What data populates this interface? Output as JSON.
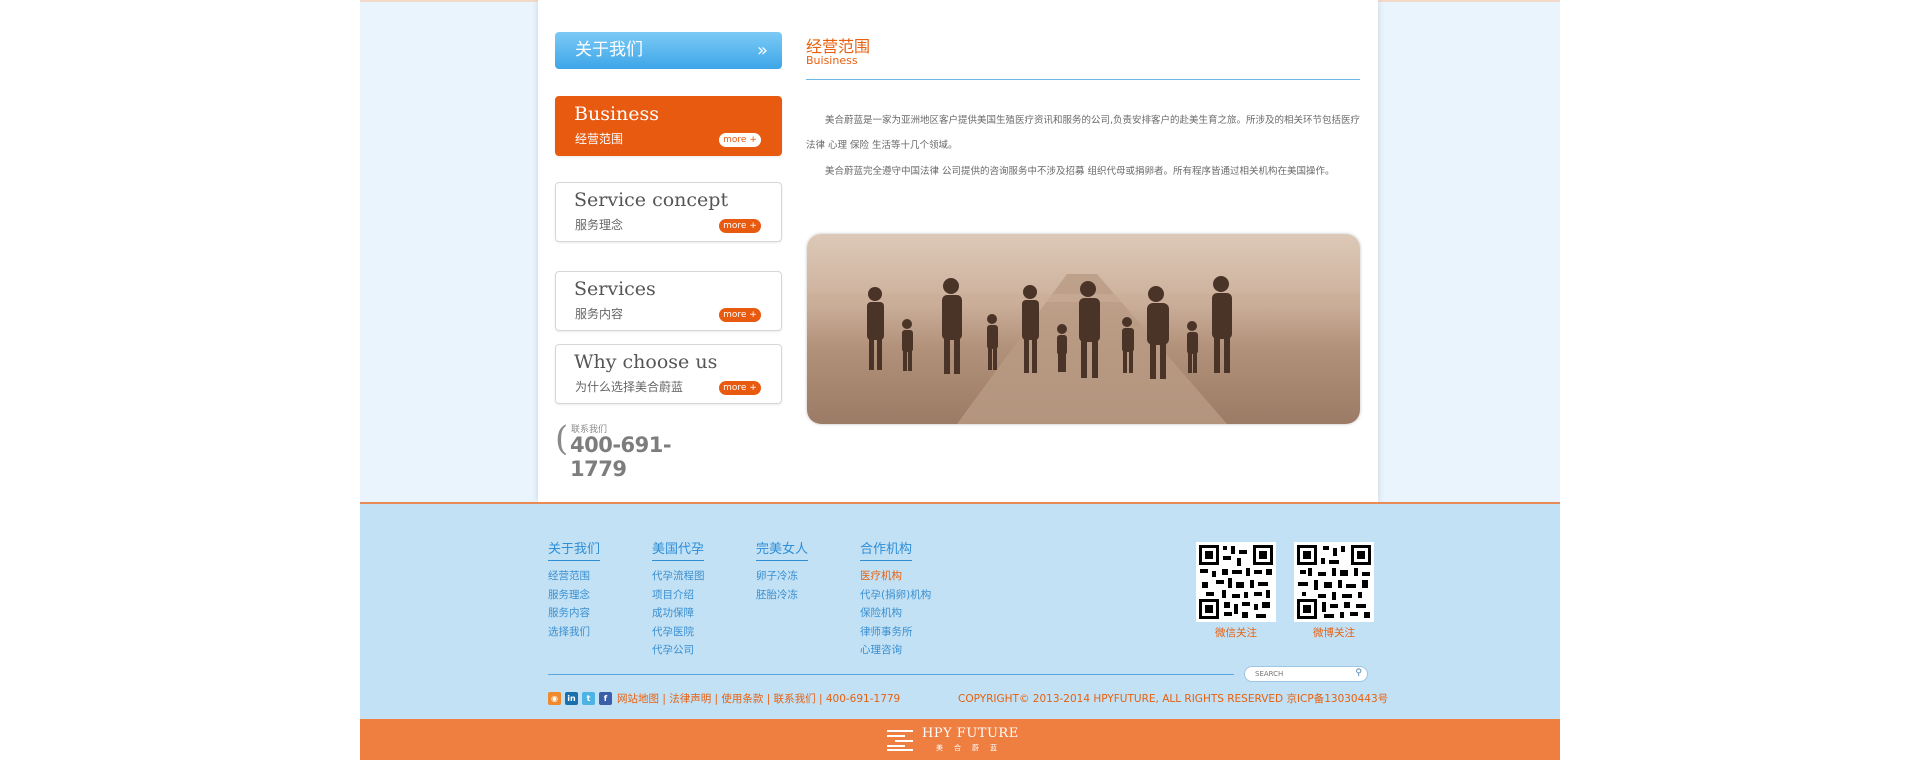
{
  "sidebar": {
    "header": "关于我们",
    "header_icon": "double-chevron-right-icon",
    "items": [
      {
        "en": "Business",
        "cn": "经营范围",
        "more": "more +",
        "active": true
      },
      {
        "en": "Service concept",
        "cn": "服务理念",
        "more": "more +",
        "active": false
      },
      {
        "en": "Services",
        "cn": "服务内容",
        "more": "more +",
        "active": false
      },
      {
        "en": "Why choose us",
        "cn": "为什么选择美合蔚蓝",
        "more": "more +",
        "active": false
      }
    ],
    "contact_label": "联系我们",
    "phone": "400-691-1779"
  },
  "main": {
    "title": "经营范围",
    "subtitle": "Buisiness",
    "paragraphs": [
      "　　美合蔚蓝是一家为亚洲地区客户提供美国生殖医疗资讯和服务的公司,负责安排客户的赴美生育之旅。所涉及的相关环节包括医疗 法律 心理 保险 生活等十几个领域。",
      "　　美合蔚蓝完全遵守中国法律 公司提供的咨询服务中不涉及招募 组织代母或捐卵者。所有程序皆通过相关机构在美国操作。"
    ],
    "photo": "family-walking-on-road-photo"
  },
  "footer": {
    "columns": [
      {
        "heading": "关于我们",
        "links": [
          "经营范围",
          "服务理念",
          "服务内容",
          "选择我们"
        ]
      },
      {
        "heading": "美国代孕",
        "links": [
          "代孕流程图",
          "项目介绍",
          "成功保障",
          "代孕医院",
          "代孕公司"
        ]
      },
      {
        "heading": "完美女人",
        "links": [
          "卵子冷冻",
          "胚胎冷冻"
        ]
      },
      {
        "heading": "合作机构",
        "links": [
          "医疗机构",
          "代孕(捐卵)机构",
          "保险机构",
          "律师事务所",
          "心理咨询"
        ]
      }
    ],
    "qr_codes": [
      {
        "label": "微信关注"
      },
      {
        "label": "微博关注"
      }
    ],
    "search_placeholder": "SEARCH",
    "social_icons": [
      "rss-icon",
      "linkedin-icon",
      "twitter-icon",
      "facebook-icon"
    ],
    "links_text": "网站地图 | 法律声明 | 使用条款 | 联系我们 | 400-691-1779",
    "copyright": "COPYRIGHT© 2013-2014 HPYFUTURE, ALL RIGHTS RESERVED  京ICP备13030443号",
    "brand_en": "HPY FUTURE",
    "brand_cn": "美合蔚蓝"
  },
  "colors": {
    "accent_orange": "#e85a10",
    "accent_blue": "#3da6e8",
    "footer_bg": "#c2e1f5",
    "bottom_bar": "#ef7e41"
  }
}
